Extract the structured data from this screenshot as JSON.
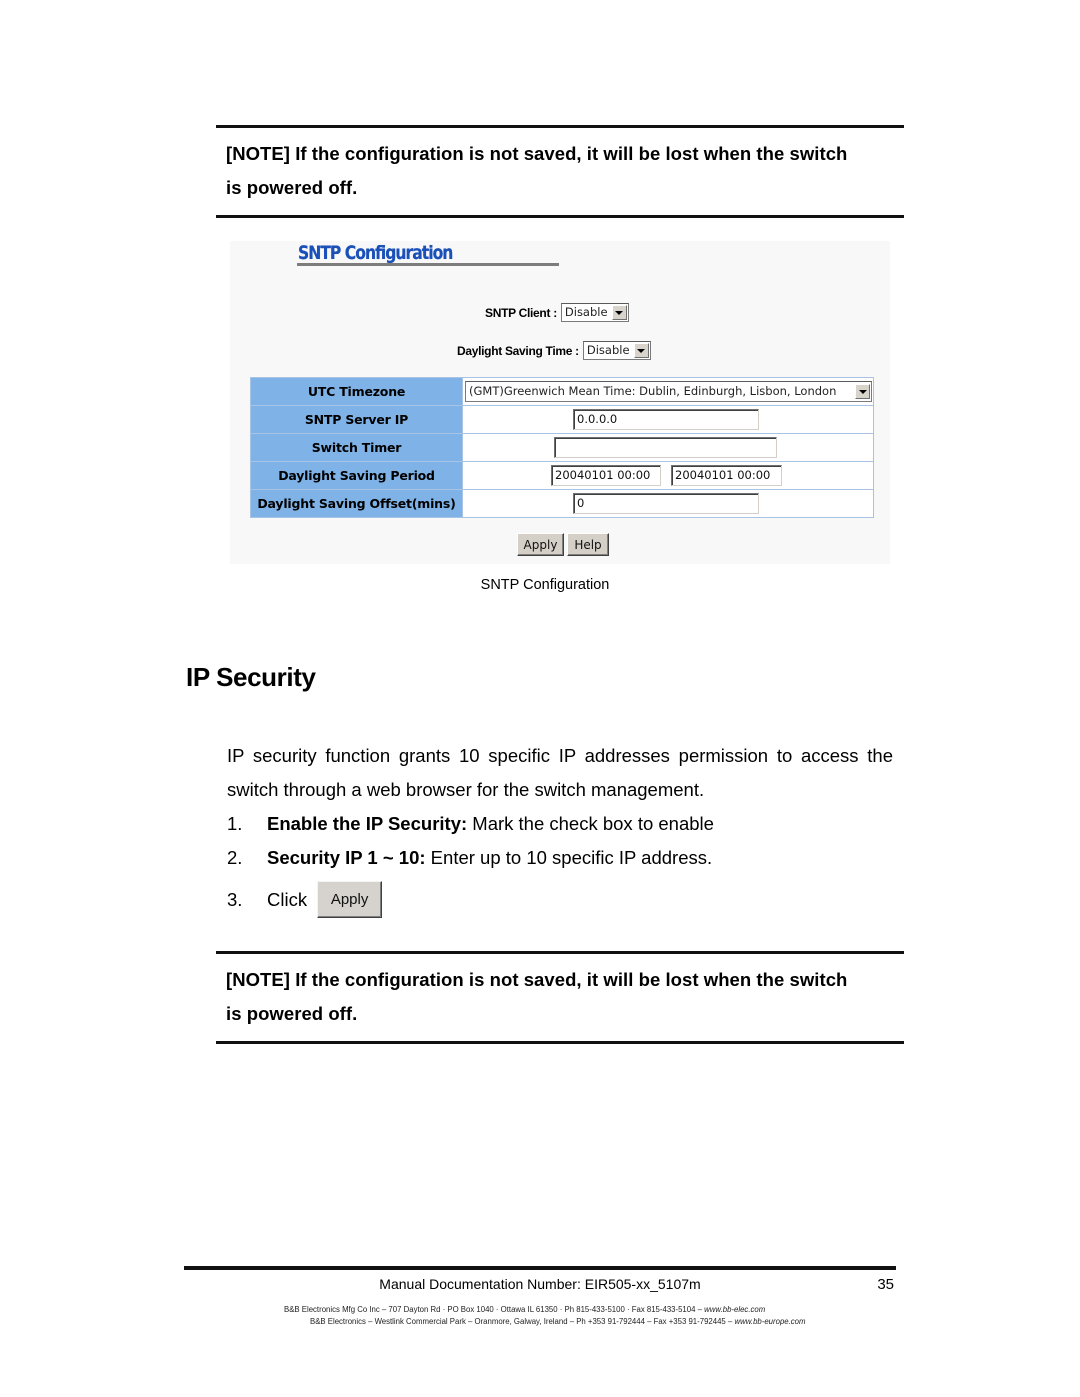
{
  "notes": [
    {
      "text_line1": "[NOTE] If the configuration is not saved, it will be lost when the switch",
      "text_line2": "is powered off."
    },
    {
      "text_line1": "[NOTE] If the configuration is not saved, it will be lost when the switch",
      "text_line2": "is powered off."
    }
  ],
  "sntp_panel": {
    "title": "SNTP Configuration",
    "title_color": "#1a50b8",
    "sntp_client": {
      "label": "SNTP Client :",
      "value": "Disable"
    },
    "daylight_saving_time": {
      "label": "Daylight Saving Time :",
      "value": "Disable"
    },
    "rows": [
      {
        "label": "UTC Timezone",
        "value": "(GMT)Greenwich Mean Time: Dublin, Edinburgh, Lisbon, London"
      },
      {
        "label": "SNTP Server IP",
        "value": "0.0.0.0"
      },
      {
        "label": "Switch Timer",
        "value": ""
      },
      {
        "label": "Daylight Saving Period",
        "value_start": "20040101 00:00",
        "value_end": "20040101 00:00"
      },
      {
        "label": "Daylight Saving Offset(mins)",
        "value": "0"
      }
    ],
    "label_bg_color": "#7fb3e8",
    "buttons": {
      "apply": "Apply",
      "help": "Help"
    }
  },
  "figure_caption": "SNTP Configuration",
  "section": {
    "title": "IP Security",
    "intro": "IP security function grants 10 specific IP addresses permission to access the switch through a web browser for the switch management.",
    "steps": [
      {
        "num": "1.",
        "bold": "Enable the IP Security:",
        "text": " Mark the check box to enable"
      },
      {
        "num": "2.",
        "bold": "Security IP 1 ~ 10:",
        "text": " Enter up to 10 specific IP address."
      },
      {
        "num": "3.",
        "text": "Click",
        "button": "Apply"
      }
    ]
  },
  "footer": {
    "doc_number": "Manual Documentation Number: EIR505-xx_5107m",
    "page_number": "35",
    "address_us": "B&B Electronics Mfg Co Inc – 707 Dayton Rd · PO Box 1040 · Ottawa IL 61350 · Ph 815-433-5100 · Fax 815-433-5104 – ",
    "url_us": "www.bb-elec.com",
    "address_eu": "B&B Electronics – Westlink Commercial Park – Oranmore, Galway, Ireland – Ph +353 91-792444 – Fax +353 91-792445 – ",
    "url_eu": "www.bb-europe.com"
  }
}
